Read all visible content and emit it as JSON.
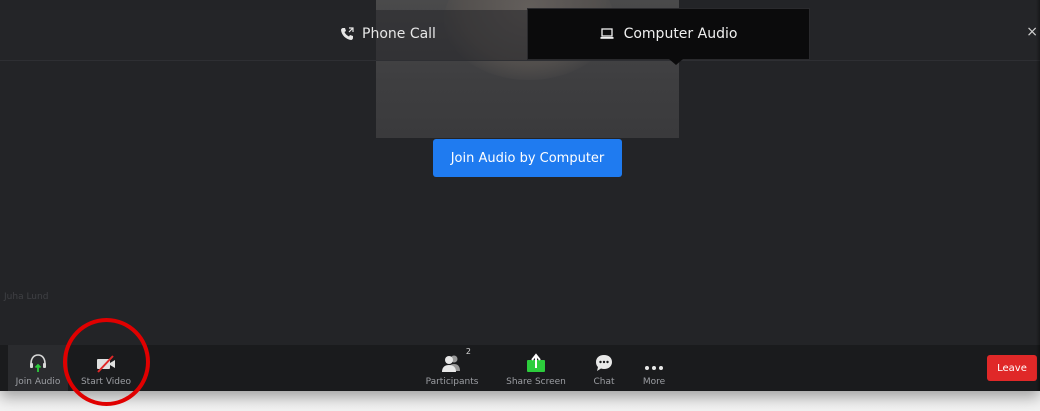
{
  "header": {
    "tabs": [
      {
        "label": "Phone Call",
        "icon": "phone-icon",
        "active": false
      },
      {
        "label": "Computer Audio",
        "icon": "laptop-icon",
        "active": true
      }
    ],
    "close_label": "×"
  },
  "main": {
    "join_audio_button": "Join Audio by Computer",
    "participant_name": "Juha Lund"
  },
  "toolbar": {
    "join_audio": {
      "label": "Join Audio",
      "icon": "headphones-icon"
    },
    "start_video": {
      "label": "Start Video",
      "icon": "video-off-icon"
    },
    "participants": {
      "label": "Participants",
      "icon": "participants-icon",
      "count": "2"
    },
    "share_screen": {
      "label": "Share Screen",
      "icon": "share-screen-icon"
    },
    "chat": {
      "label": "Chat",
      "icon": "chat-icon"
    },
    "more": {
      "label": "More",
      "icon": "more-icon"
    },
    "leave": {
      "label": "Leave"
    }
  },
  "colors": {
    "background": "#232427",
    "toolbar": "#1a1b1d",
    "accent_blue": "#1f7bf0",
    "leave_red": "#e02828",
    "share_green": "#2ccd3c",
    "annotation_red": "#e00000"
  }
}
